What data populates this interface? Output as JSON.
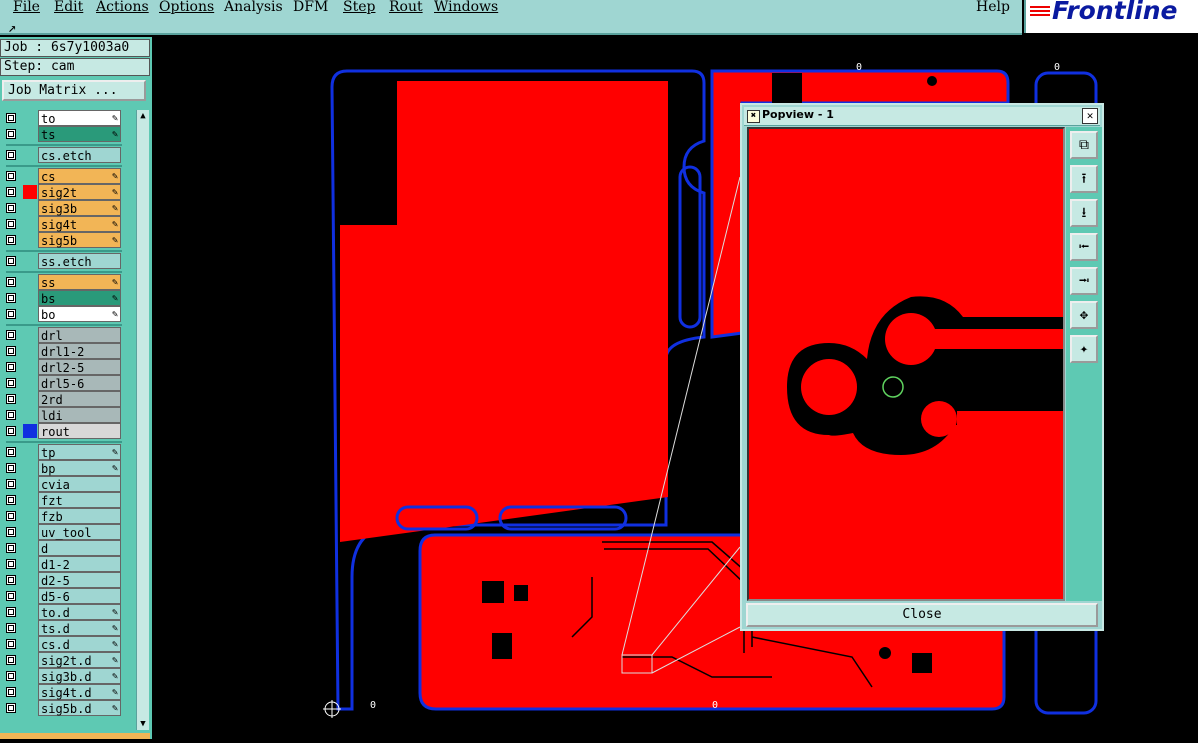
{
  "menu": {
    "items": [
      {
        "label": "File"
      },
      {
        "label": "Edit"
      },
      {
        "label": "Actions"
      },
      {
        "label": "Options"
      },
      {
        "label": "Analysis"
      },
      {
        "label": "DFM"
      },
      {
        "label": "Step"
      },
      {
        "label": "Rout"
      },
      {
        "label": "Windows"
      }
    ],
    "help": "Help"
  },
  "logo": {
    "text": "Frontline"
  },
  "job": {
    "job_label": "Job : 6s7y1003a0",
    "step_label": "Step: cam",
    "matrix_button": "Job Matrix ..."
  },
  "layers": [
    {
      "name": "to",
      "color": "#ffffff",
      "swatch": "",
      "edit": true
    },
    {
      "name": "ts",
      "color": "#2a9a7a",
      "swatch": "",
      "edit": true
    },
    {
      "name": "cs.etch",
      "color": "#9fd6d2",
      "swatch": "",
      "edit": false
    },
    {
      "name": "cs",
      "color": "#f2b556",
      "swatch": "",
      "edit": true
    },
    {
      "name": "sig2t",
      "color": "#f2b556",
      "swatch": "#ff0000",
      "edit": true
    },
    {
      "name": "sig3b",
      "color": "#f2b556",
      "swatch": "",
      "edit": true
    },
    {
      "name": "sig4t",
      "color": "#f2b556",
      "swatch": "",
      "edit": true
    },
    {
      "name": "sig5b",
      "color": "#f2b556",
      "swatch": "",
      "edit": true
    },
    {
      "name": "ss.etch",
      "color": "#9fd6d2",
      "swatch": "",
      "edit": false
    },
    {
      "name": "ss",
      "color": "#f2b556",
      "swatch": "",
      "edit": true
    },
    {
      "name": "bs",
      "color": "#2a9a7a",
      "swatch": "",
      "edit": true
    },
    {
      "name": "bo",
      "color": "#ffffff",
      "swatch": "",
      "edit": true
    },
    {
      "name": "drl",
      "color": "#a8b8b8",
      "swatch": "",
      "edit": false
    },
    {
      "name": "drl1-2",
      "color": "#a8b8b8",
      "swatch": "",
      "edit": false
    },
    {
      "name": "drl2-5",
      "color": "#a8b8b8",
      "swatch": "",
      "edit": false
    },
    {
      "name": "drl5-6",
      "color": "#a8b8b8",
      "swatch": "",
      "edit": false
    },
    {
      "name": "2rd",
      "color": "#a8b8b8",
      "swatch": "",
      "edit": false
    },
    {
      "name": "ldi",
      "color": "#a8b8b8",
      "swatch": "",
      "edit": false
    },
    {
      "name": "rout",
      "color": "#d8d8d8",
      "swatch": "#1030e0",
      "edit": false
    },
    {
      "name": "tp",
      "color": "#9fd6d2",
      "swatch": "",
      "edit": true
    },
    {
      "name": "bp",
      "color": "#9fd6d2",
      "swatch": "",
      "edit": true
    },
    {
      "name": "cvia",
      "color": "#9fd6d2",
      "swatch": "",
      "edit": false
    },
    {
      "name": "fzt",
      "color": "#9fd6d2",
      "swatch": "",
      "edit": false
    },
    {
      "name": "fzb",
      "color": "#9fd6d2",
      "swatch": "",
      "edit": false
    },
    {
      "name": "uv_tool",
      "color": "#9fd6d2",
      "swatch": "",
      "edit": false
    },
    {
      "name": "d",
      "color": "#9fd6d2",
      "swatch": "",
      "edit": false
    },
    {
      "name": "d1-2",
      "color": "#9fd6d2",
      "swatch": "",
      "edit": false
    },
    {
      "name": "d2-5",
      "color": "#9fd6d2",
      "swatch": "",
      "edit": false
    },
    {
      "name": "d5-6",
      "color": "#9fd6d2",
      "swatch": "",
      "edit": false
    },
    {
      "name": "to.d",
      "color": "#9fd6d2",
      "swatch": "",
      "edit": true
    },
    {
      "name": "ts.d",
      "color": "#9fd6d2",
      "swatch": "",
      "edit": true
    },
    {
      "name": "cs.d",
      "color": "#9fd6d2",
      "swatch": "",
      "edit": true
    },
    {
      "name": "sig2t.d",
      "color": "#9fd6d2",
      "swatch": "",
      "edit": true
    },
    {
      "name": "sig3b.d",
      "color": "#9fd6d2",
      "swatch": "",
      "edit": true
    },
    {
      "name": "sig4t.d",
      "color": "#9fd6d2",
      "swatch": "",
      "edit": true
    },
    {
      "name": "sig5b.d",
      "color": "#9fd6d2",
      "swatch": "",
      "edit": true
    }
  ],
  "popview": {
    "title": "Popview - 1",
    "close_label": "Close"
  },
  "origin_markers": [
    "0",
    "0",
    "0",
    "0"
  ],
  "colors": {
    "copper": "#ff0000",
    "rout": "#1030e0",
    "panel": "#5ec9b3",
    "background": "#000000"
  }
}
